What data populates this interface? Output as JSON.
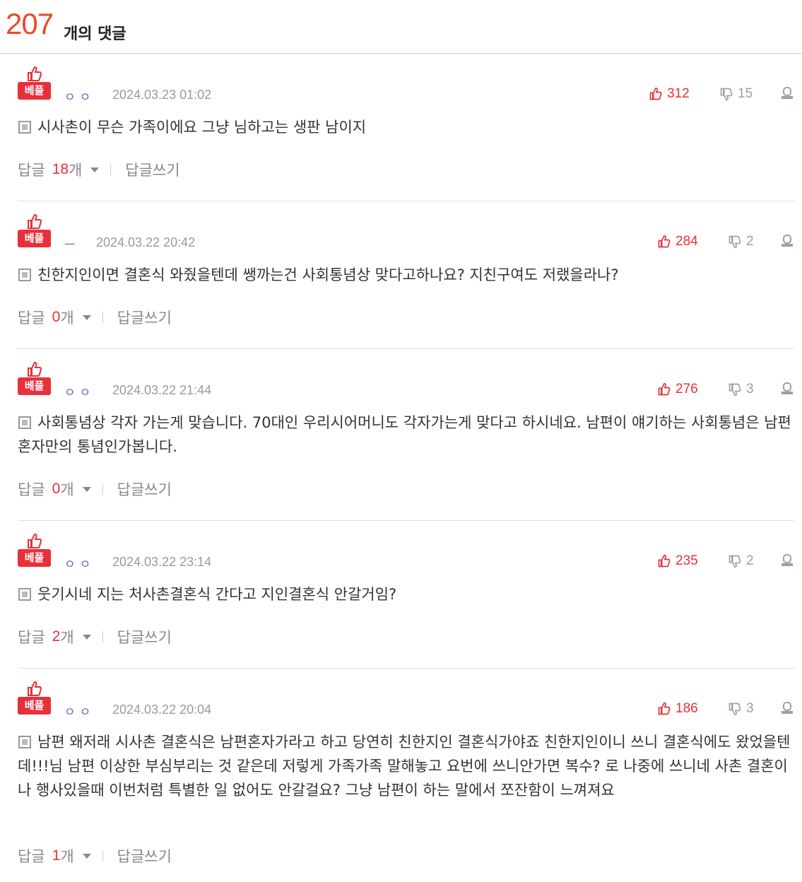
{
  "header": {
    "count": "207",
    "count_label": "개의 댓글"
  },
  "labels": {
    "best": "베플",
    "reply": "답글",
    "reply_unit": "개",
    "write_reply": "답글쓰기"
  },
  "comments": [
    {
      "author": "ㅇㅇ",
      "date": "2024.03.23 01:02",
      "likes": "312",
      "dislikes": "15",
      "text": "시사촌이 무슨 가족이에요 그냥 님하고는 생판 남이지",
      "reply_count": "18"
    },
    {
      "author": "ㅡ",
      "date": "2024.03.22 20:42",
      "likes": "284",
      "dislikes": "2",
      "text": "친한지인이면 결혼식 와줬을텐데 쌩까는건 사회통념상 맞다고하나요? 지친구여도 저랬을라나?",
      "reply_count": "0"
    },
    {
      "author": "ㅇㅇ",
      "date": "2024.03.22 21:44",
      "likes": "276",
      "dislikes": "3",
      "text": "사회통념상 각자 가는게 맞습니다. 70대인 우리시어머니도 각자가는게 맞다고 하시네요. 남편이 얘기하는 사회통념은 남편혼자만의 통념인가봅니다.",
      "reply_count": "0"
    },
    {
      "author": "ㅇㅇ",
      "date": "2024.03.22 23:14",
      "likes": "235",
      "dislikes": "2",
      "text": "웃기시네 지는 처사촌결혼식 간다고 지인결혼식 안갈거임?",
      "reply_count": "2"
    },
    {
      "author": "ㅇㅇ",
      "date": "2024.03.22 20:04",
      "likes": "186",
      "dislikes": "3",
      "text": "남편 왜저래 시사촌 결혼식은 남편혼자가라고 하고 당연히 친한지인 결혼식가야죠 친한지인이니 쓰니 결혼식에도 왔었을텐데!!!님 남편 이상한 부심부리는 것 같은데 저렇게 가족가족 말해놓고 요번에 쓰니안가면 복수? 로 나중에 쓰니네 사촌 결혼이나 행사있을때 이번처럼 특별한 일 없어도 안갈걸요? 그냥 남편이 하는 말에서 쪼잔함이 느껴져요",
      "reply_count": "1"
    }
  ],
  "colors": {
    "accent": "#e8303a",
    "count": "#e8492b",
    "author": "#5a6bbf",
    "muted": "#9a9a9a"
  },
  "icons": {
    "like": "thumbs-up-icon",
    "dislike": "thumbs-down-icon",
    "report": "report-icon",
    "text": "document-icon",
    "best": "best-thumb-icon"
  }
}
